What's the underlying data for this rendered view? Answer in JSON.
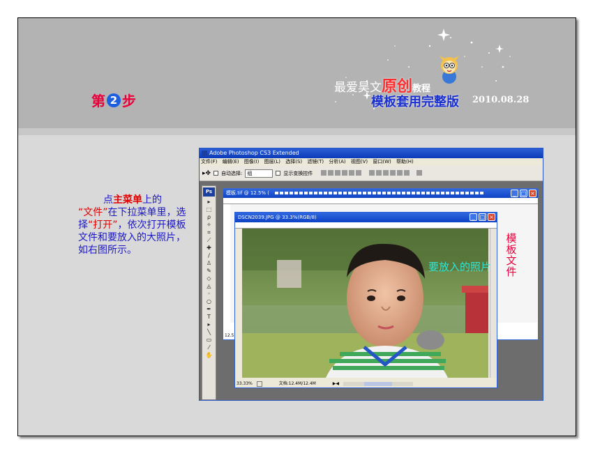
{
  "step": {
    "prefix": "第",
    "number": "2",
    "suffix": "步"
  },
  "brand": {
    "author": "最爱昊文",
    "original": "原创",
    "tutorial": "教程",
    "title": "模板套用完整版",
    "date": "2010.08.28"
  },
  "instructions": {
    "p1": "点",
    "h1": "主菜单",
    "p2": "上的",
    "q1": "“",
    "h2": "文件",
    "q2": "”",
    "p3": "在下拉菜单里，选择",
    "q3": "“",
    "h3": "打开",
    "q4": "”",
    "p4": "，依次打开模板文件和要放入的大照片，如右图所示。"
  },
  "photoshop": {
    "app_title": "Adobe Photoshop CS3 Extended",
    "menu": [
      "文件(F)",
      "编辑(E)",
      "图像(I)",
      "图层(L)",
      "选择(S)",
      "滤镜(T)",
      "分析(A)",
      "视图(V)",
      "窗口(W)",
      "帮助(H)"
    ],
    "options": {
      "auto_select_label": "自动选择:",
      "auto_select_value": "组",
      "show_transform_label": "显示变换控件"
    },
    "template_doc": {
      "title": "模板.tif @ 12.5% (",
      "zoom": "12.5"
    },
    "photo_doc": {
      "title": "DSCN2039.JPG @ 33.3%(RGB/8)",
      "zoom": "33.33%",
      "doc_size": "文档:12.4M/12.4M"
    }
  },
  "labels": {
    "photo_label": "要放入的照片",
    "template_label": "模板文件"
  },
  "colors": {
    "accent_red": "#e00000",
    "instruction_blue": "#1b16c9",
    "title_blue": "#1a2fd0",
    "photo_label_cyan": "#2ee7d7"
  }
}
